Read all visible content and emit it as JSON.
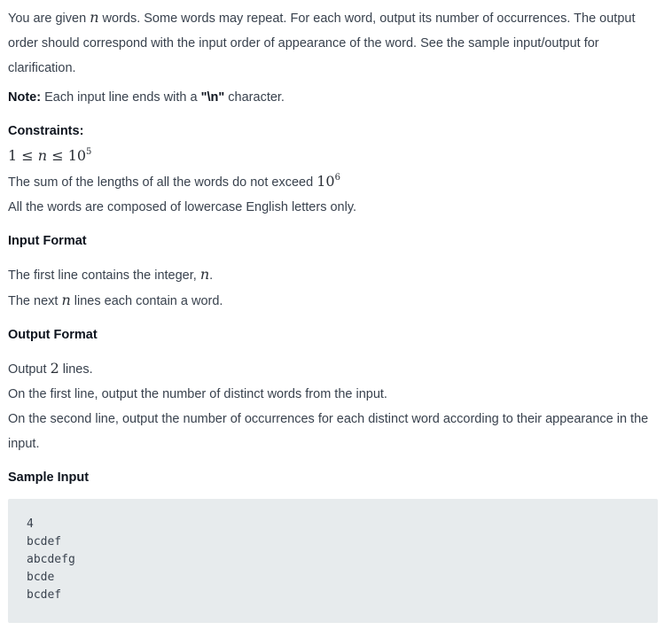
{
  "problem": {
    "intro": {
      "pre": "You are given ",
      "var": "n",
      "post": " words. Some words may repeat. For each word, output its number of occurrences. The output order should correspond with the input order of appearance of the word. See the sample input/output for clarification."
    },
    "note": {
      "label": "Note:",
      "pre": " Each input line ends with a ",
      "code": "\"\\n\"",
      "post": " character."
    },
    "constraints": {
      "heading": "Constraints:",
      "range": {
        "lower": "1",
        "op1": "≤",
        "var": "n",
        "op2": "≤",
        "base": "10",
        "exp": "5"
      },
      "sum_line": {
        "text": "The sum of the lengths of all the words do not exceed ",
        "base": "10",
        "exp": "6"
      },
      "letters_line": "All the words are composed of lowercase English letters only."
    },
    "input_format": {
      "heading": "Input Format",
      "line1": {
        "pre": "The first line contains the integer, ",
        "var": "n",
        "post": "."
      },
      "line2": {
        "pre": "The next ",
        "var": "n",
        "post": " lines each contain a word."
      }
    },
    "output_format": {
      "heading": "Output Format",
      "line1": {
        "pre": "Output ",
        "num": "2",
        "post": " lines."
      },
      "line2": "On the first line, output the number of distinct words from the input.",
      "line3": "On the second line, output the number of occurrences for each distinct word according to their appearance in the input."
    },
    "sample_input": {
      "heading": "Sample Input",
      "lines": [
        "4",
        "bcdef",
        "abcdefg",
        "bcde",
        "bcdef"
      ]
    }
  }
}
